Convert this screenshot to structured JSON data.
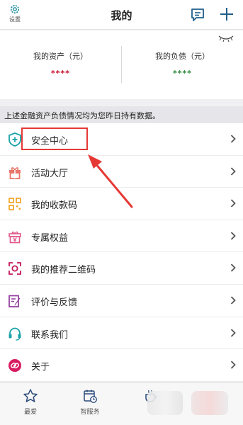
{
  "header": {
    "settings_label": "设置",
    "title": "我的"
  },
  "assets": {
    "assets_label": "我的资产（元）",
    "assets_value": "****",
    "liabilities_label": "我的负债（元）",
    "liabilities_value": "****"
  },
  "notice": "上述金融资产负债情况均为您昨日持有数据。",
  "menu": {
    "items": [
      {
        "label": "安全中心",
        "icon": "shield-plus-icon"
      },
      {
        "label": "活动大厅",
        "icon": "gift-icon"
      },
      {
        "label": "我的收款码",
        "icon": "qr-code-icon"
      },
      {
        "label": "专属权益",
        "icon": "yen-gift-icon"
      },
      {
        "label": "我的推荐二维码",
        "icon": "scan-icon"
      },
      {
        "label": "评价与反馈",
        "icon": "edit-icon"
      },
      {
        "label": "联系我们",
        "icon": "headset-icon"
      },
      {
        "label": "关于",
        "icon": "link-icon"
      }
    ]
  },
  "tabbar": {
    "tab1_label": "最爱",
    "tab2_label": "智服务"
  },
  "colors": {
    "accent_teal": "#1aa0a0",
    "assets_red": "#c8102e",
    "liabilities_green": "#2e8b3e",
    "annotation_red": "#e53935"
  }
}
